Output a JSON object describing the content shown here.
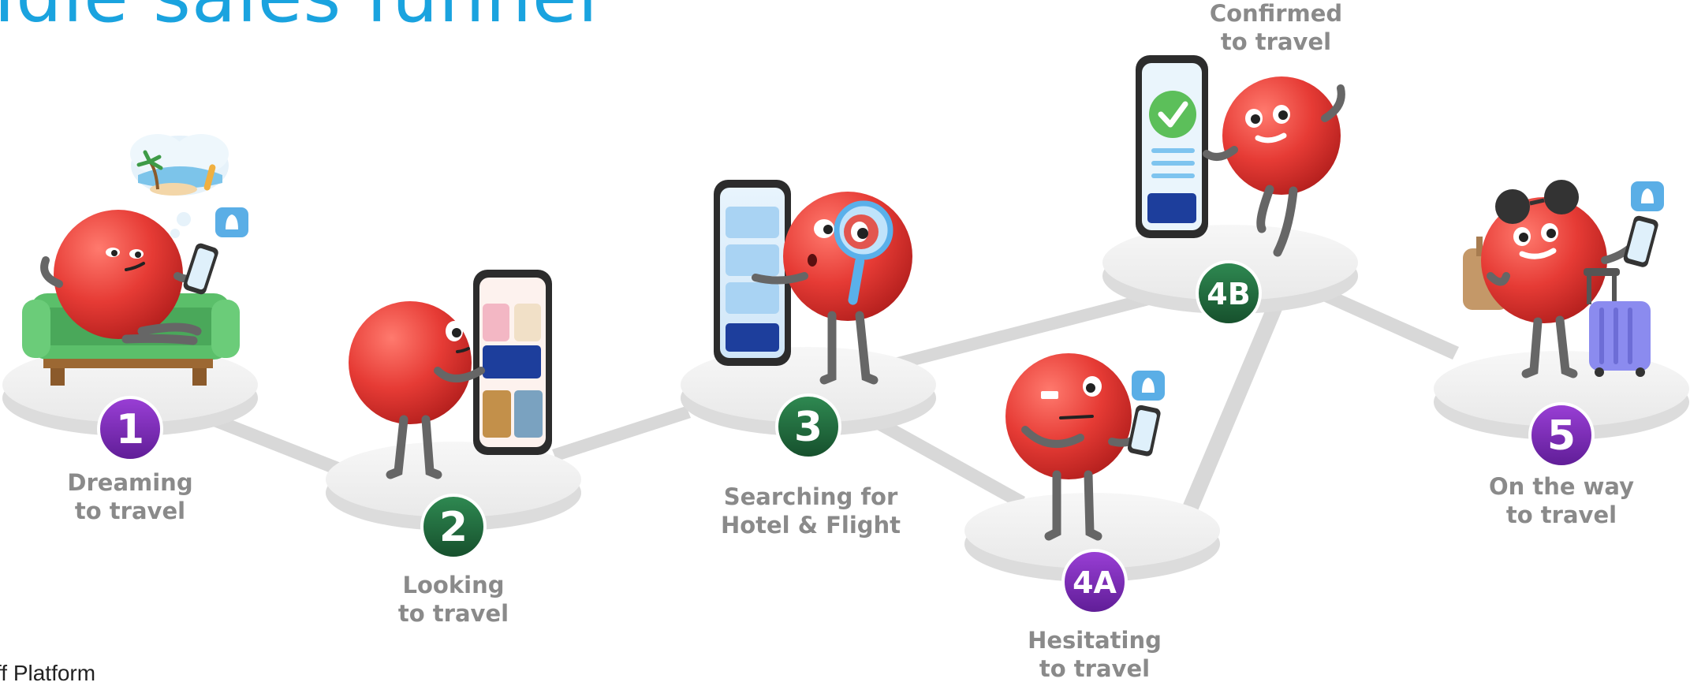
{
  "page": {
    "title": "Idle sales funnel",
    "footer": "ff Platform",
    "colors": {
      "title": "#1aa3df",
      "purple": "#7b2bb5",
      "green": "#1f6e3e",
      "ball": "#e63b35",
      "label": "#8a8a8a"
    }
  },
  "stages": [
    {
      "id": "1",
      "badge_color": "purple",
      "line1": "Dreaming",
      "line2": "to travel"
    },
    {
      "id": "2",
      "badge_color": "green",
      "line1": "Looking",
      "line2": "to travel"
    },
    {
      "id": "3",
      "badge_color": "green",
      "line1": "Searching for",
      "line2": "Hotel & Flight"
    },
    {
      "id": "4A",
      "badge_color": "purple",
      "line1": "Hesitating",
      "line2": "to travel"
    },
    {
      "id": "4B",
      "badge_color": "green",
      "line1": "Confirmed",
      "line2": "to travel"
    },
    {
      "id": "5",
      "badge_color": "purple",
      "line1": "On the way",
      "line2": "to travel"
    }
  ]
}
